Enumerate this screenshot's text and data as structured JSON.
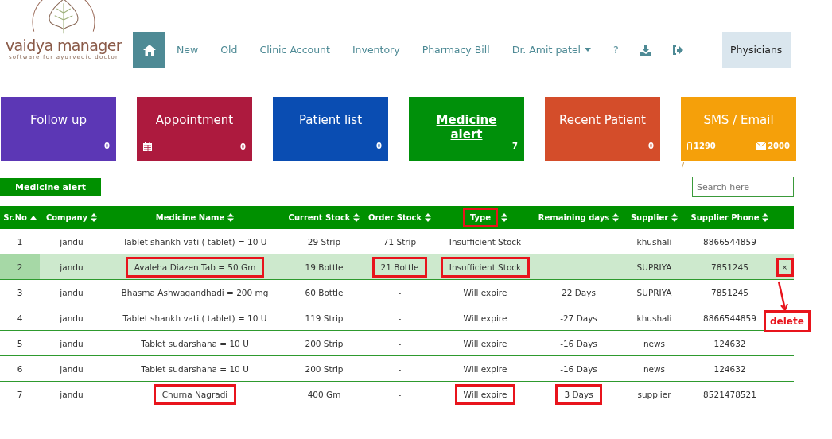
{
  "logo": {
    "name": "vaidya manager",
    "tagline": "software for ayurvedic doctor"
  },
  "nav": [
    {
      "kind": "home",
      "selected": true
    },
    {
      "kind": "link",
      "label": "New"
    },
    {
      "kind": "link",
      "label": "Old"
    },
    {
      "kind": "link",
      "label": "Clinic Account"
    },
    {
      "kind": "link",
      "label": "Inventory"
    },
    {
      "kind": "link",
      "label": "Pharmacy Bill"
    },
    {
      "kind": "dropdown",
      "label": "Dr. Amit patel"
    },
    {
      "kind": "link",
      "label": "?"
    },
    {
      "kind": "download"
    },
    {
      "kind": "logout"
    },
    {
      "kind": "panel",
      "label": "Physicians"
    }
  ],
  "tiles": [
    {
      "title": "Follow up",
      "color": "#5c37b5",
      "count": "0",
      "active": false
    },
    {
      "title": "Appointment",
      "color": "#ad1a3e",
      "count": "0",
      "active": false,
      "kind": "calendar"
    },
    {
      "title": "Patient list",
      "color": "#0a4db2",
      "count": "0",
      "active": false
    },
    {
      "title": "Medicine alert",
      "color": "#00900a",
      "count": "7",
      "active": true
    },
    {
      "title": "Recent Patient",
      "color": "#d44d2a",
      "count": "0",
      "active": false
    },
    {
      "title": "SMS / Email",
      "color": "#f5a00a",
      "active": false,
      "sms": "1290",
      "email": "2000",
      "footnote": "/"
    }
  ],
  "section_label": "Medicine alert",
  "search": {
    "placeholder": "Search here"
  },
  "table": {
    "columns": [
      {
        "label": "Sr.No",
        "sorted": true,
        "marked": false
      },
      {
        "label": "Company",
        "sorted": false,
        "marked": false
      },
      {
        "label": "Medicine Name",
        "sorted": false,
        "marked": false
      },
      {
        "label": "Current Stock",
        "sorted": false,
        "marked": false
      },
      {
        "label": "Order Stock",
        "sorted": false,
        "marked": false
      },
      {
        "label": "Type",
        "sorted": false,
        "marked": true
      },
      {
        "label": "Remaining days",
        "sorted": false,
        "marked": false
      },
      {
        "label": "Supplier",
        "sorted": false,
        "marked": false
      },
      {
        "label": "Supplier Phone",
        "sorted": false,
        "marked": false
      }
    ],
    "rows": [
      {
        "selected": false,
        "cells": [
          {
            "text": "1",
            "marked": false
          },
          {
            "text": "jandu",
            "marked": false
          },
          {
            "text": "Tablet shankh vati ( tablet) = 10 U",
            "marked": false
          },
          {
            "text": "29 Strip",
            "marked": false
          },
          {
            "text": "71 Strip",
            "marked": false
          },
          {
            "text": "Insufficient Stock",
            "marked": false
          },
          {
            "marked": false
          },
          {
            "text": "khushali",
            "marked": false
          },
          {
            "text": "8866544859",
            "marked": false
          }
        ]
      },
      {
        "selected": true,
        "delete": {
          "label": "×",
          "marked": true
        },
        "cells": [
          {
            "text": "2",
            "marked": false
          },
          {
            "text": "jandu",
            "marked": false
          },
          {
            "text": "Avaleha Diazen Tab = 50 Gm",
            "marked": true
          },
          {
            "text": "19 Bottle",
            "marked": false
          },
          {
            "text": "21 Bottle",
            "marked": true
          },
          {
            "text": "Insufficient Stock",
            "marked": true
          },
          {
            "marked": false
          },
          {
            "text": "SUPRIYA",
            "marked": false
          },
          {
            "text": "7851245",
            "marked": false
          }
        ]
      },
      {
        "selected": false,
        "cells": [
          {
            "text": "3",
            "marked": false
          },
          {
            "text": "jandu",
            "marked": false
          },
          {
            "text": "Bhasma Ashwagandhadi = 200 mg",
            "marked": false
          },
          {
            "text": "60 Bottle",
            "marked": false
          },
          {
            "text": "-",
            "marked": false
          },
          {
            "text": "Will expire",
            "marked": false
          },
          {
            "text": "22 Days",
            "marked": false
          },
          {
            "text": "SUPRIYA",
            "marked": false
          },
          {
            "text": "7851245",
            "marked": false
          }
        ]
      },
      {
        "selected": false,
        "cells": [
          {
            "text": "4",
            "marked": false
          },
          {
            "text": "jandu",
            "marked": false
          },
          {
            "text": "Tablet shankh vati ( tablet) = 10 U",
            "marked": false
          },
          {
            "text": "119 Strip",
            "marked": false
          },
          {
            "text": "-",
            "marked": false
          },
          {
            "text": "Will expire",
            "marked": false
          },
          {
            "text": "-27 Days",
            "marked": false
          },
          {
            "text": "khushali",
            "marked": false
          },
          {
            "text": "8866544859",
            "marked": false
          }
        ]
      },
      {
        "selected": false,
        "cells": [
          {
            "text": "5",
            "marked": false
          },
          {
            "text": "jandu",
            "marked": false
          },
          {
            "text": "Tablet sudarshana = 10 U",
            "marked": false
          },
          {
            "text": "200 Strip",
            "marked": false
          },
          {
            "text": "-",
            "marked": false
          },
          {
            "text": "Will expire",
            "marked": false
          },
          {
            "text": "-16 Days",
            "marked": false
          },
          {
            "text": "news",
            "marked": false
          },
          {
            "text": "124632",
            "marked": false
          }
        ]
      },
      {
        "selected": false,
        "cells": [
          {
            "text": "6",
            "marked": false
          },
          {
            "text": "jandu",
            "marked": false
          },
          {
            "text": "Tablet sudarshana = 10 U",
            "marked": false
          },
          {
            "text": "200 Strip",
            "marked": false
          },
          {
            "text": "-",
            "marked": false
          },
          {
            "text": "Will expire",
            "marked": false
          },
          {
            "text": "-16 Days",
            "marked": false
          },
          {
            "text": "news",
            "marked": false
          },
          {
            "text": "124632",
            "marked": false
          }
        ]
      },
      {
        "selected": false,
        "cells": [
          {
            "text": "7",
            "marked": false
          },
          {
            "text": "jandu",
            "marked": false
          },
          {
            "text": "Churna Nagradi",
            "marked": true
          },
          {
            "text": "400 Gm",
            "marked": false
          },
          {
            "text": "-",
            "marked": false
          },
          {
            "text": "Will expire",
            "marked": true
          },
          {
            "text": "3 Days",
            "marked": true
          },
          {
            "text": "supplier",
            "marked": false
          },
          {
            "text": "8521478521",
            "marked": false
          }
        ]
      }
    ]
  },
  "callout": {
    "label": "delete"
  }
}
